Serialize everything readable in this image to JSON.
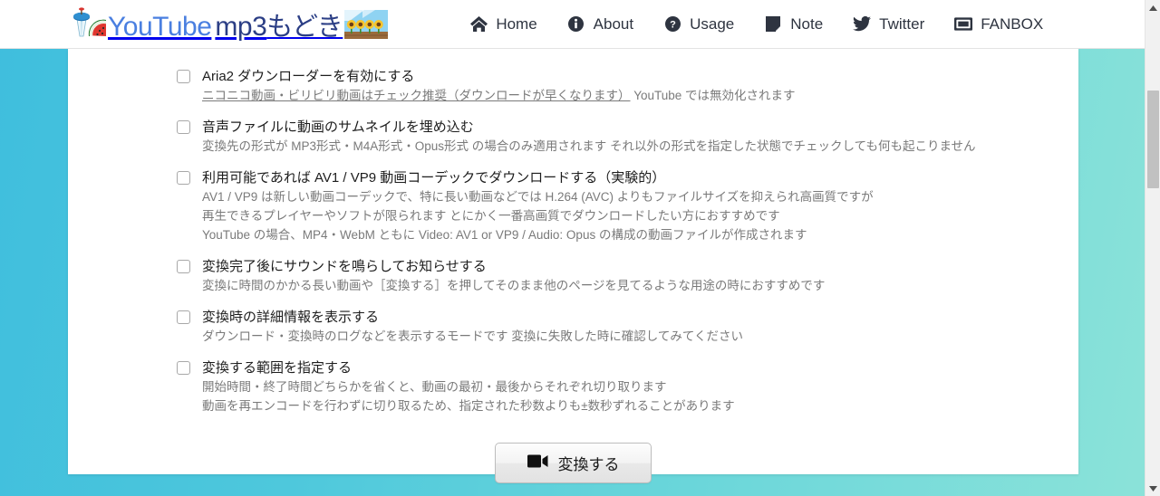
{
  "header": {
    "brand": {
      "you_tube": "YouTube",
      "mp3": "mp3",
      "jp_suffix": "もどき",
      "left_logo_name": "watermelon-shaved-ice-logo",
      "right_logo_name": "sunflower-field-logo"
    },
    "nav": [
      {
        "label": "Home",
        "icon": "home-icon"
      },
      {
        "label": "About",
        "icon": "info-circle-icon"
      },
      {
        "label": "Usage",
        "icon": "question-circle-icon"
      },
      {
        "label": "Note",
        "icon": "note-page-icon"
      },
      {
        "label": "Twitter",
        "icon": "twitter-bird-icon"
      },
      {
        "label": "FANBOX",
        "icon": "fanbox-rectangle-icon"
      }
    ]
  },
  "options": [
    {
      "name": "aria2-downloader",
      "checked": false,
      "title": "Aria2 ダウンローダーを有効にする",
      "desc_lines": [
        {
          "underline": "ニコニコ動画・ビリビリ動画はチェック推奨（ダウンロードが早くなります）",
          "plain": " YouTube では無効化されます"
        }
      ]
    },
    {
      "name": "embed-thumbnail",
      "checked": false,
      "title": "音声ファイルに動画のサムネイルを埋め込む",
      "desc_lines": [
        {
          "plain": "変換先の形式が MP3形式・M4A形式・Opus形式 の場合のみ適用されます それ以外の形式を指定した状態でチェックしても何も起こりません"
        }
      ]
    },
    {
      "name": "av1-vp9-codec",
      "checked": false,
      "title": "利用可能であれば AV1 / VP9 動画コーデックでダウンロードする（実験的）",
      "desc_lines": [
        {
          "plain": "AV1 / VP9 は新しい動画コーデックで、特に長い動画などでは H.264 (AVC) よりもファイルサイズを抑えられ高画質ですが"
        },
        {
          "plain": "再生できるプレイヤーやソフトが限られます とにかく一番高画質でダウンロードしたい方におすすめです"
        },
        {
          "plain": "YouTube の場合、MP4・WebM ともに Video: AV1 or VP9 / Audio: Opus の構成の動画ファイルが作成されます"
        }
      ]
    },
    {
      "name": "sound-notify",
      "checked": false,
      "title": "変換完了後にサウンドを鳴らしてお知らせする",
      "desc_lines": [
        {
          "plain": "変換に時間のかかる長い動画や［変換する］を押してそのまま他のページを見てるような用途の時におすすめです"
        }
      ]
    },
    {
      "name": "verbose-info",
      "checked": false,
      "title": "変換時の詳細情報を表示する",
      "desc_lines": [
        {
          "plain": "ダウンロード・変換時のログなどを表示するモードです 変換に失敗した時に確認してみてください"
        }
      ]
    },
    {
      "name": "trim-range",
      "checked": false,
      "title": "変換する範囲を指定する",
      "desc_lines": [
        {
          "plain": "開始時間・終了時間どちらかを省くと、動画の最初・最後からそれぞれ切り取ります"
        },
        {
          "plain": "動画を再エンコードを行わずに切り取るため、指定された秒数よりも±数秒ずれることがあります"
        }
      ]
    }
  ],
  "convert_button": {
    "label": "変換する",
    "icon": "video-camera-icon"
  },
  "colors": {
    "background_left": "#3fbedd",
    "background_right": "#8ce3d9",
    "card": "#ffffff",
    "title_text": "#1d1d1d",
    "desc_text": "#7a7a7a",
    "nav_text": "#2e3440",
    "brand_blue": "#4a7fe0",
    "brand_navy": "#2b3e85"
  }
}
